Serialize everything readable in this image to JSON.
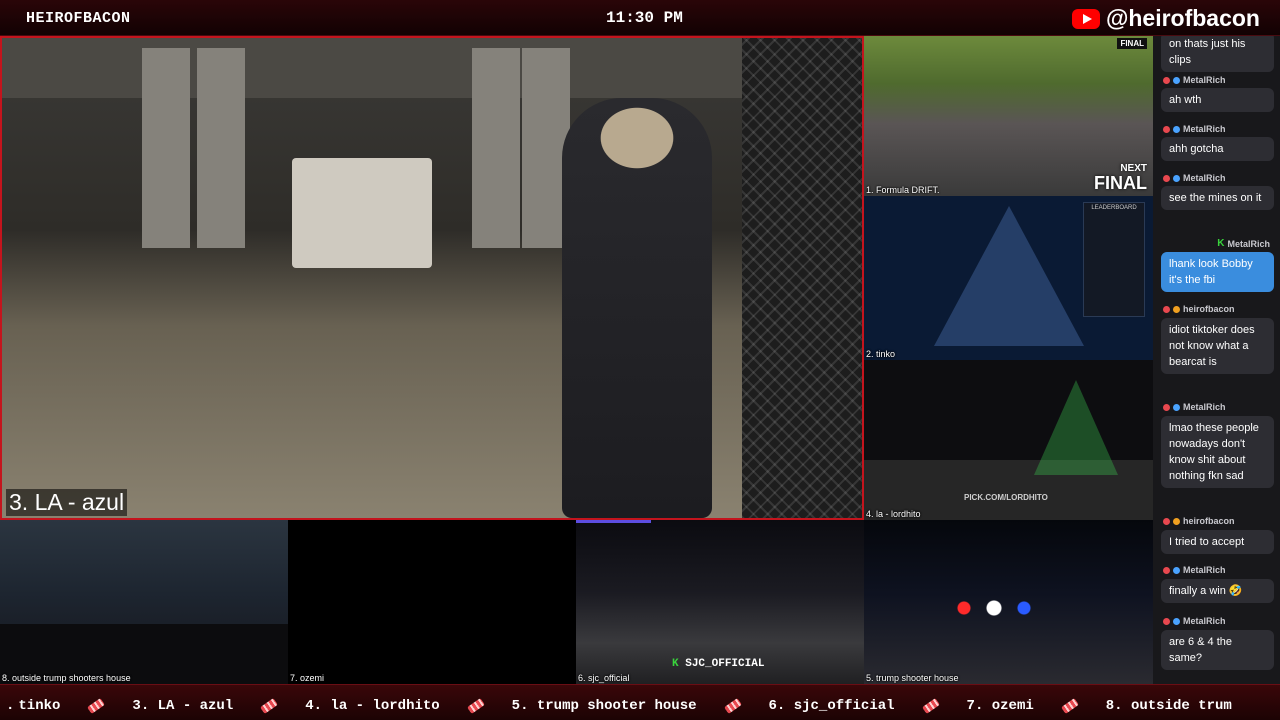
{
  "header": {
    "channel": "HEIROFBACON",
    "clock": "11:30 PM",
    "youtube_handle": "@heirofbacon",
    "youtube_icon": "youtube-icon"
  },
  "main_feed": {
    "label": "3. LA - azul"
  },
  "side_feeds": [
    {
      "label": "1. Formula DRIFT.",
      "badge_line1": "NEXT",
      "badge_line2": "FINAL",
      "top_badge": "FINAL"
    },
    {
      "label": "2. tinko",
      "board_title": "LEADERBOARD"
    },
    {
      "label": "4. la - lordhito",
      "watermark": "PICK.COM/LORDHITO"
    }
  ],
  "bottom_feeds": [
    {
      "label": "8. outside trump shooters house"
    },
    {
      "label": "7. ozemi"
    },
    {
      "label": "6. sjc_official",
      "overlay": "SJC_OFFICIAL",
      "overlay_k": "K"
    },
    {
      "label": "5. trump shooter house"
    }
  ],
  "chat": {
    "messages": [
      {
        "user": "",
        "text": "on thats just his clips"
      },
      {
        "user": "MetalRich",
        "text": "ah wth"
      },
      {
        "user": "MetalRich",
        "text": "ahh gotcha"
      },
      {
        "user": "MetalRich",
        "text": "see the mines on it"
      },
      {
        "user": "MetalRich",
        "text": "lhank look Bobby it's the fbi",
        "mine": true
      },
      {
        "user": "heirofbacon",
        "text": "idiot tiktoker does not know what a bearcat is"
      },
      {
        "user": "MetalRich",
        "text": "lmao these people nowadays don't know shit about nothing fkn sad"
      },
      {
        "user": "heirofbacon",
        "text": "I tried to accept"
      },
      {
        "user": "MetalRich",
        "text": "finally a win 🤣"
      },
      {
        "user": "MetalRich",
        "text": "are 6 & 4 the same?"
      }
    ],
    "colors": {
      "bubble": "#2d2d33",
      "mine_bubble": "#3a8dde",
      "badge_blue": "#4aa3ff",
      "badge_gold": "#f0a020"
    }
  },
  "ticker": {
    "items": [
      "tinko",
      "3. LA - azul",
      "4. la - lordhito",
      "5. trump shooter house",
      "6. sjc_official",
      "7. ozemi",
      "8. outside trum"
    ],
    "first_prefix": "."
  },
  "theme": {
    "accent": "#c4141d",
    "bar_bg": "#1c0304"
  }
}
